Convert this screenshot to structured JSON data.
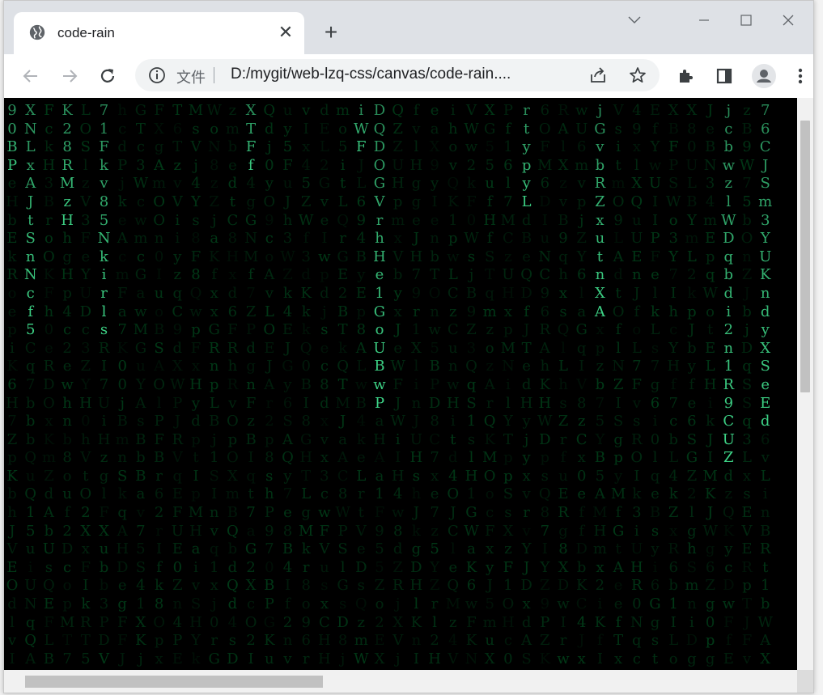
{
  "browser": {
    "tab": {
      "title": "code-rain",
      "favicon": "globe-icon",
      "close_glyph": "✕"
    },
    "new_tab_glyph": "+",
    "window_controls": [
      "chevron-down-icon",
      "minimize-icon",
      "maximize-icon",
      "close-icon"
    ],
    "omnibox": {
      "scheme_label": "文件",
      "url": "D:/mygit/web-lzq-css/canvas/code-rain....",
      "icons": [
        "info-icon",
        "share-icon",
        "star-icon"
      ]
    },
    "toolbar_icons": [
      "back-icon",
      "forward-icon",
      "reload-icon",
      "extensions-icon",
      "side-panel-icon",
      "profile-icon",
      "menu-icon"
    ]
  },
  "page": {
    "background": "#000000",
    "rain_color": "#00ff66",
    "rain_columns": [
      {
        "head": "90BP"
      },
      {
        "head": "XNLxAJtSnNcf5"
      },
      {
        "head": ""
      },
      {
        "head": "K28RMzH"
      },
      {
        "head": ""
      },
      {
        "head": "71Fkv85Nkirls"
      },
      {
        "head": ""
      },
      {
        "head": ""
      },
      {
        "head": ""
      },
      {
        "head": ""
      },
      {
        "head": ""
      },
      {
        "head": ""
      },
      {
        "head": ""
      },
      {
        "head": "XTFf"
      },
      {
        "head": ""
      },
      {
        "head": ""
      },
      {
        "head": ""
      },
      {
        "head": ""
      },
      {
        "head": ""
      },
      {
        "head": "iWF"
      },
      {
        "head": "DQDOGVrhHe1GoUBwP"
      },
      {
        "head": ""
      },
      {
        "head": ""
      },
      {
        "head": ""
      },
      {
        "head": ""
      },
      {
        "head": ""
      },
      {
        "head": ""
      },
      {
        "head": ""
      },
      {
        "head": "rtypyL"
      },
      {
        "head": ""
      },
      {
        "head": ""
      },
      {
        "head": ""
      },
      {
        "head": "jGvbRZxutnXA"
      },
      {
        "head": ""
      },
      {
        "head": ""
      },
      {
        "head": ""
      },
      {
        "head": ""
      },
      {
        "head": ""
      },
      {
        "head": ""
      },
      {
        "head": "jcbwzlWDqbdi2n1R9CUZ"
      },
      {
        "head": ""
      },
      {
        "head": "76CJSm3YUKndyXSeEd"
      }
    ]
  }
}
